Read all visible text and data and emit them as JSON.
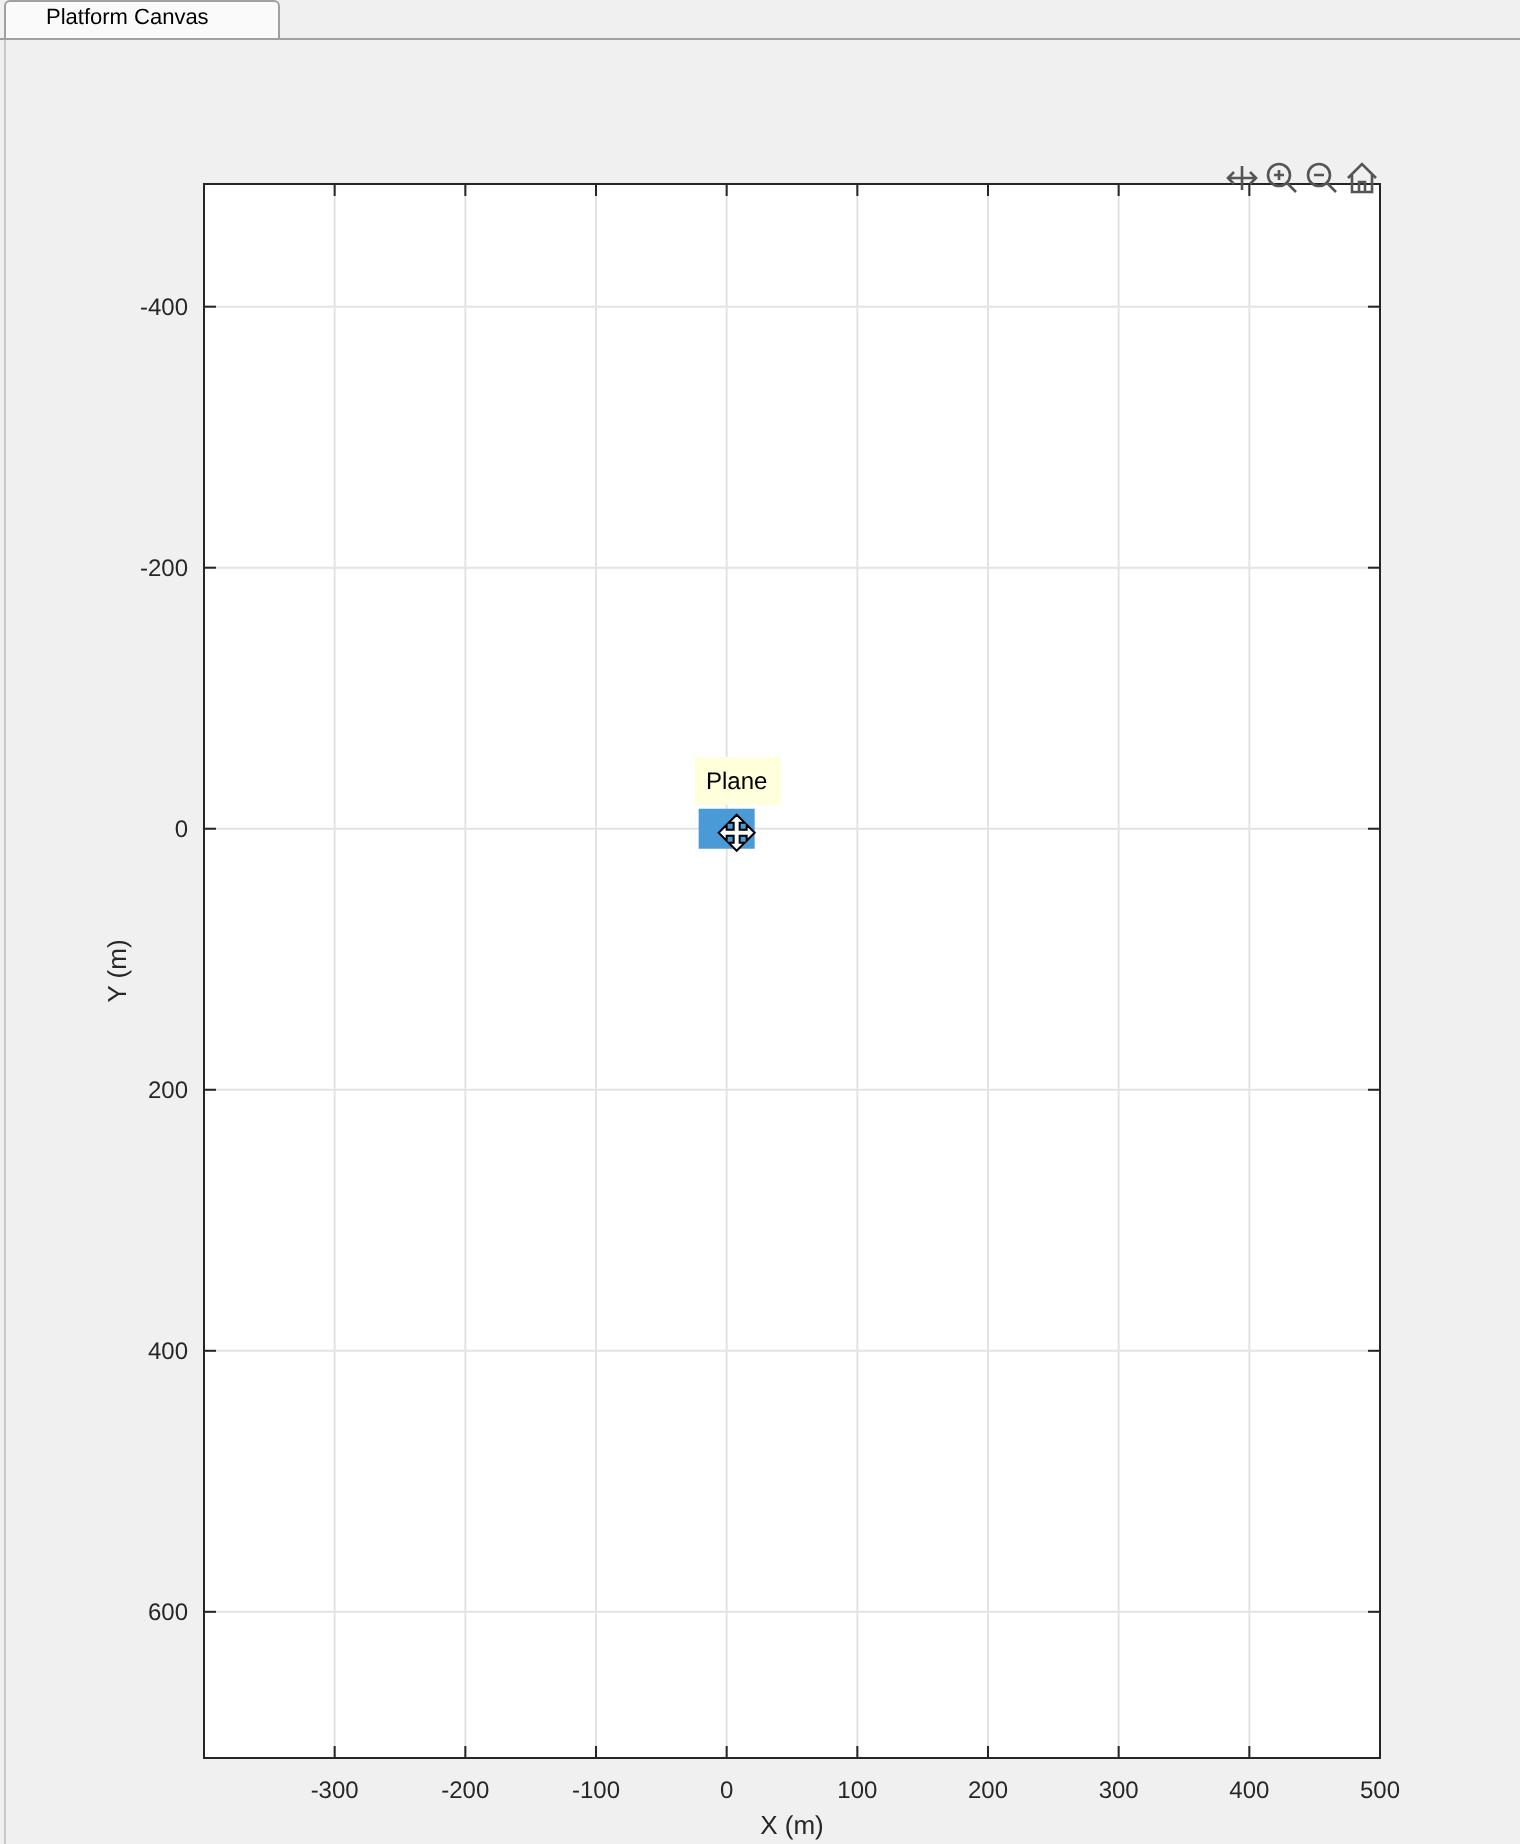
{
  "tabs": [
    {
      "label": "Platform Canvas",
      "selected": true
    }
  ],
  "canvas": {
    "chart_data": {
      "type": "scatter",
      "xlabel": "X (m)",
      "ylabel": "Y (m)",
      "x": [
        0
      ],
      "series": [
        {
          "name": "Plane",
          "color": "#4a9ad8",
          "values": [
            0
          ]
        }
      ],
      "xlim": [
        -400,
        500
      ],
      "ylim": [
        712,
        -494
      ],
      "xticks": [
        -300,
        -200,
        -100,
        0,
        100,
        200,
        300,
        400,
        500
      ],
      "yticks": [
        -400,
        -200,
        0,
        200,
        400,
        600
      ],
      "grid": true
    }
  }
}
